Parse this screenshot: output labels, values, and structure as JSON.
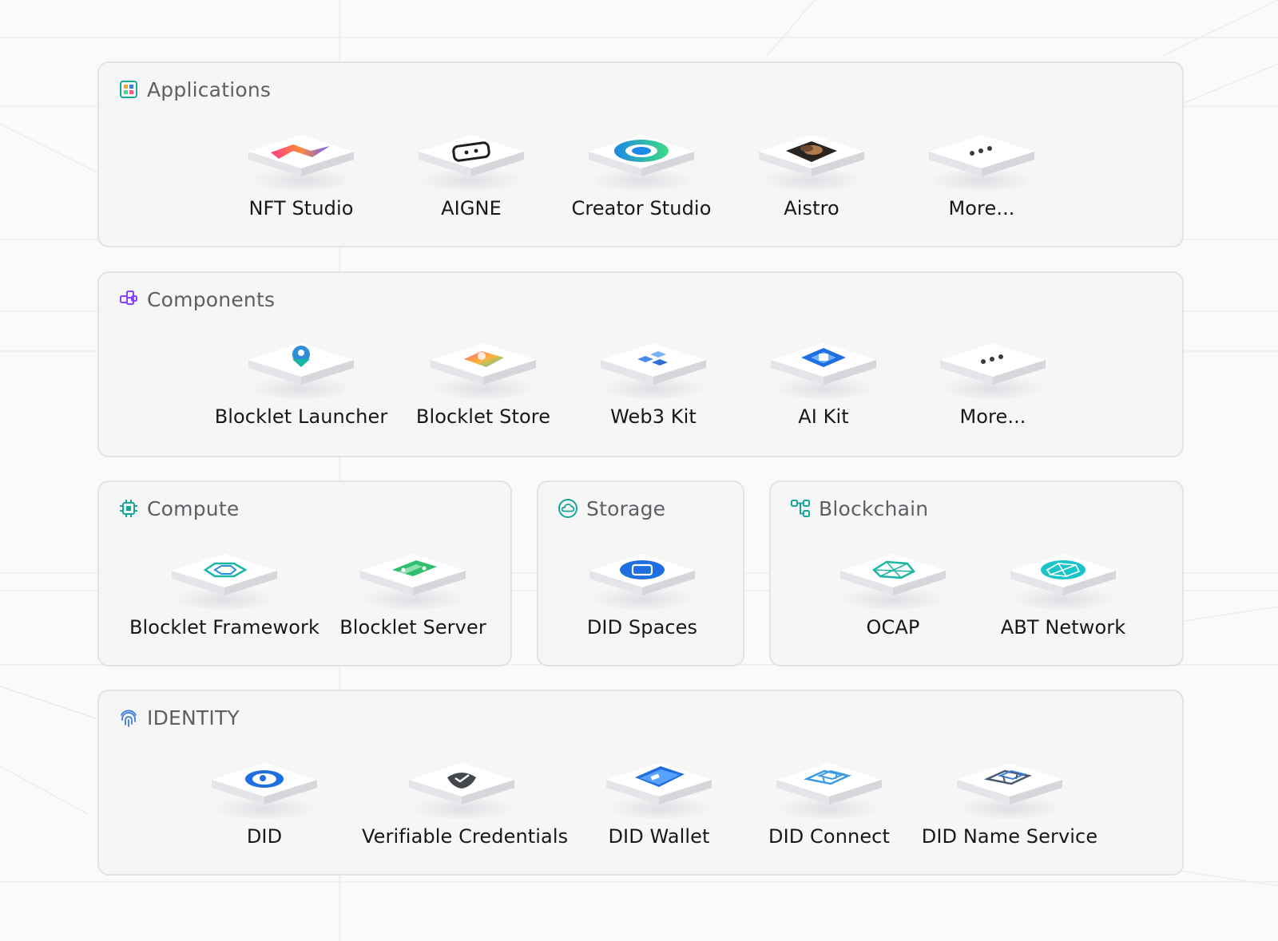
{
  "colors": {
    "accent_green": "#16a79a",
    "accent_purple": "#8a3ffc",
    "accent_blue": "#3b7dde"
  },
  "sections": {
    "applications": {
      "title": "Applications",
      "icon": "apps-grid-icon",
      "items": [
        {
          "label": "NFT Studio",
          "icon": "nft-studio-logo-icon"
        },
        {
          "label": "AIGNE",
          "icon": "aigne-logo-icon"
        },
        {
          "label": "Creator Studio",
          "icon": "creator-studio-logo-icon"
        },
        {
          "label": "Aistro",
          "icon": "aistro-portrait-icon"
        },
        {
          "label": "More...",
          "icon": "more-dots-icon"
        }
      ]
    },
    "components": {
      "title": "Components",
      "icon": "components-blocks-icon",
      "items": [
        {
          "label": "Blocklet Launcher",
          "icon": "rocket-icon"
        },
        {
          "label": "Blocklet Store",
          "icon": "store-bag-icon"
        },
        {
          "label": "Web3 Kit",
          "icon": "web3-kit-cubes-icon"
        },
        {
          "label": "AI Kit",
          "icon": "ai-chip-icon"
        },
        {
          "label": "More...",
          "icon": "more-dots-icon"
        }
      ]
    },
    "compute": {
      "title": "Compute",
      "icon": "cpu-chip-icon",
      "items": [
        {
          "label": "Blocklet Framework",
          "icon": "framework-hexagon-icon"
        },
        {
          "label": "Blocklet Server",
          "icon": "server-icon"
        }
      ]
    },
    "storage": {
      "title": "Storage",
      "icon": "cloud-icon",
      "items": [
        {
          "label": "DID Spaces",
          "icon": "did-spaces-logo-icon"
        }
      ]
    },
    "blockchain": {
      "title": "Blockchain",
      "icon": "blockchain-nodes-icon",
      "items": [
        {
          "label": "OCAP",
          "icon": "ocap-network-icon"
        },
        {
          "label": "ABT Network",
          "icon": "abt-network-icon"
        }
      ]
    },
    "identity": {
      "title": "IDENTITY",
      "icon": "fingerprint-icon",
      "items": [
        {
          "label": "DID",
          "icon": "did-user-icon"
        },
        {
          "label": "Verifiable Credentials",
          "icon": "verified-shield-icon"
        },
        {
          "label": "DID Wallet",
          "icon": "did-wallet-card-icon"
        },
        {
          "label": "DID Connect",
          "icon": "did-connect-logo-icon"
        },
        {
          "label": "DID Name Service",
          "icon": "did-name-service-logo-icon"
        }
      ]
    }
  }
}
